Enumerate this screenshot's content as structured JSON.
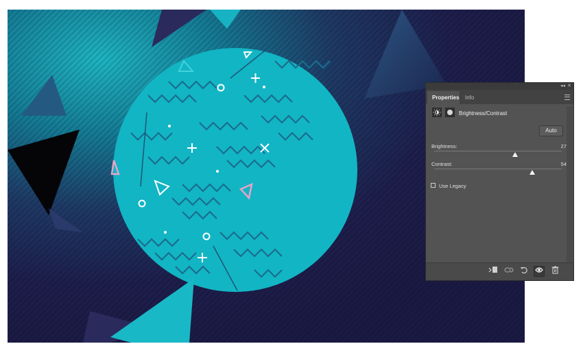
{
  "panel": {
    "tabs": [
      {
        "label": "Properties",
        "active": true
      },
      {
        "label": "Info",
        "active": false
      }
    ],
    "collapse_glyph": "◂◂",
    "close_glyph": "✕",
    "adjustment_title": "Brightness/Contrast",
    "auto_label": "Auto",
    "brightness": {
      "label": "Brightness:",
      "value": "27",
      "slider_fraction": 0.635
    },
    "contrast": {
      "label": "Contrast:",
      "value": "54",
      "slider_fraction": 0.77
    },
    "use_legacy": {
      "label": "Use Legacy",
      "checked": false
    },
    "bottom_icons": [
      "clip-to-layer-icon",
      "view-previous-icon",
      "reset-icon",
      "visibility-eye-icon",
      "trash-icon"
    ],
    "colors": {
      "panel_bg": "#535353",
      "tab_bg": "#424242",
      "canvas_bg": "#1e1a3f",
      "circle": "#12b5c4",
      "pink": "#e8a4c8"
    }
  }
}
